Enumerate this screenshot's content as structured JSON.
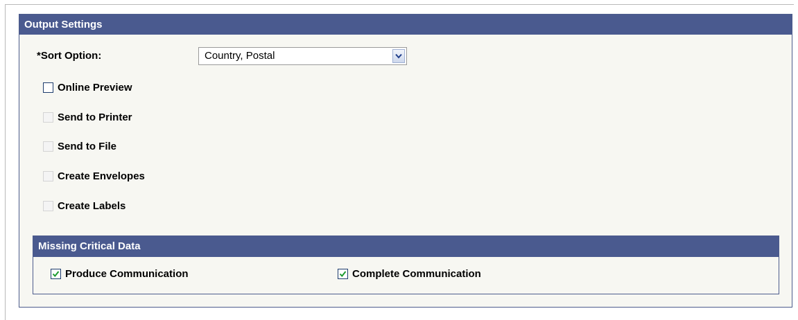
{
  "output_settings": {
    "title": "Output Settings",
    "sort_option": {
      "required_mark": "*",
      "label": "Sort Option:",
      "selected": "Country, Postal"
    },
    "checkboxes": [
      {
        "label": "Online Preview",
        "checked": false,
        "enabled": true
      },
      {
        "label": "Send to Printer",
        "checked": false,
        "enabled": false
      },
      {
        "label": "Send to File",
        "checked": false,
        "enabled": false
      },
      {
        "label": "Create Envelopes",
        "checked": false,
        "enabled": false
      },
      {
        "label": "Create Labels",
        "checked": false,
        "enabled": false
      }
    ]
  },
  "missing_critical_data": {
    "title": "Missing Critical Data",
    "checkboxes": [
      {
        "label": "Produce Communication",
        "checked": true
      },
      {
        "label": "Complete Communication",
        "checked": true
      }
    ]
  },
  "colors": {
    "header_bg": "#4a5a8f",
    "panel_bg": "#f7f7f2",
    "check_green": "#1b9a2d"
  },
  "icons": {
    "dropdown": "chevron-down-icon",
    "check": "checkmark-icon"
  }
}
